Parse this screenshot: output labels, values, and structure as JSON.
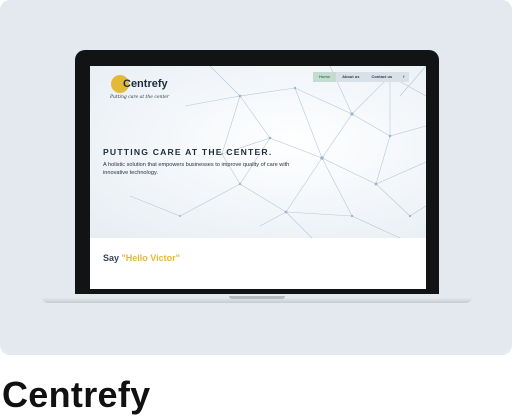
{
  "project": {
    "caption": "Centrefy"
  },
  "site": {
    "logo": {
      "name": "Centrefy",
      "tagline": "Putting care at the center",
      "accent_color": "#e4b93a"
    },
    "nav": {
      "items": [
        "Home",
        "About us",
        "Contact us"
      ],
      "active": "Home",
      "social_icon": "f"
    },
    "hero": {
      "title": "PUTTING CARE AT THE CENTER.",
      "subtitle": "A holistic solution that empowers businesses to improve quality of care with innovative technology."
    },
    "section": {
      "say_prefix": "Say ",
      "say_highlight": "\"Hello Victor\""
    }
  }
}
